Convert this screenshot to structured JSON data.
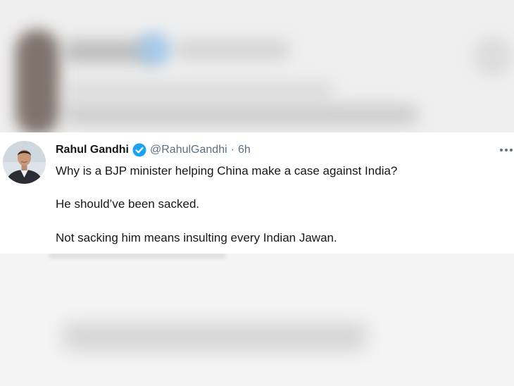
{
  "tweet": {
    "display_name": "Rahul Gandhi",
    "handle": "@RahulGandhi",
    "separator": "·",
    "time": "6h",
    "lines": [
      "Why is a BJP minister helping China make a case against India?",
      "He should’ve been sacked.",
      "Not sacking him means insulting every Indian Jawan."
    ],
    "more_icon": "more-horizontal-icon",
    "verified_icon": "verified-badge-icon",
    "accent_color": "#1da1f2"
  }
}
